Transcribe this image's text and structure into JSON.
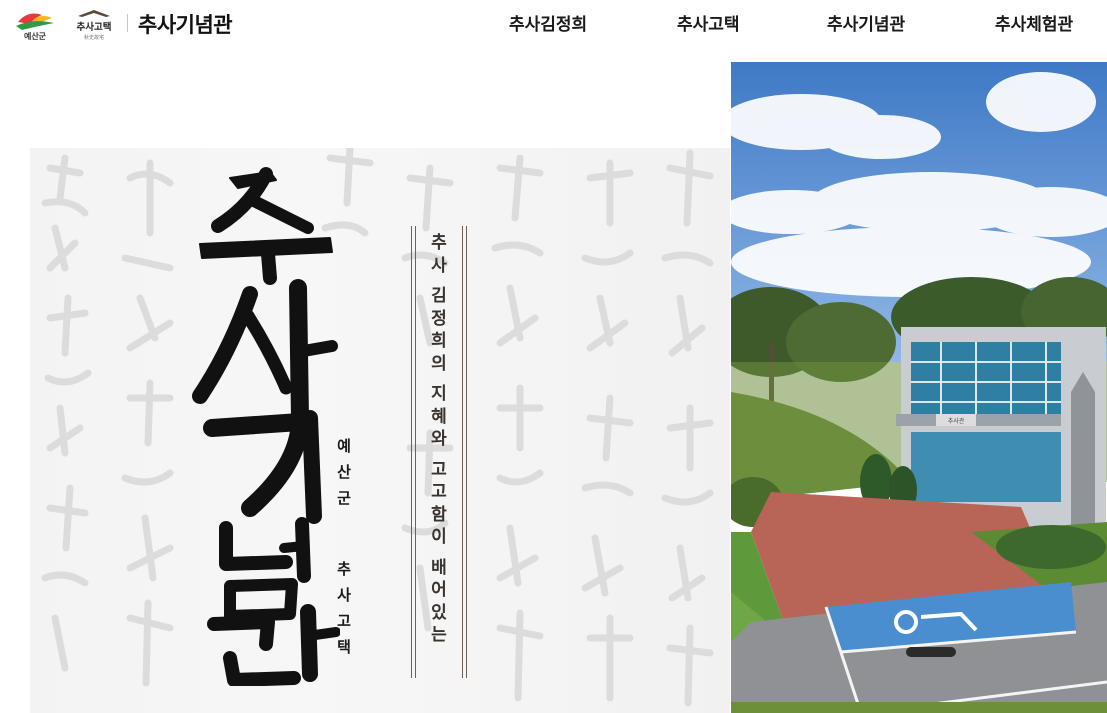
{
  "header": {
    "yesan_logo_text": "예산군",
    "gotaek_logo_text": "추사고택",
    "gotaek_logo_hanja": "秋史故宅",
    "site_title": "추사기념관"
  },
  "nav": {
    "items": [
      "추사김정희",
      "추사고택",
      "추사기념관",
      "추사체험관"
    ]
  },
  "hero": {
    "title_chars": [
      "추",
      "사",
      "기",
      "념",
      "관"
    ],
    "sub1_chars": [
      "예",
      "산",
      "군"
    ],
    "sub2_chars": [
      "추",
      "사",
      "고",
      "택"
    ],
    "tagline_chars": [
      "추",
      "사",
      " ",
      "김",
      "정",
      "희",
      "의",
      " ",
      "지",
      "혜",
      "와",
      " ",
      "고",
      "고",
      "함",
      "이",
      " ",
      "배",
      "어",
      "있",
      "는"
    ]
  },
  "photo": {
    "sign_text": "추사관"
  },
  "colors": {
    "accent_brown": "#6b6157",
    "text": "#1a1a1a",
    "sky": "#4f86cf",
    "grass": "#5e9a3c",
    "path": "#b86457",
    "parking_blue": "#4a8ed0"
  }
}
